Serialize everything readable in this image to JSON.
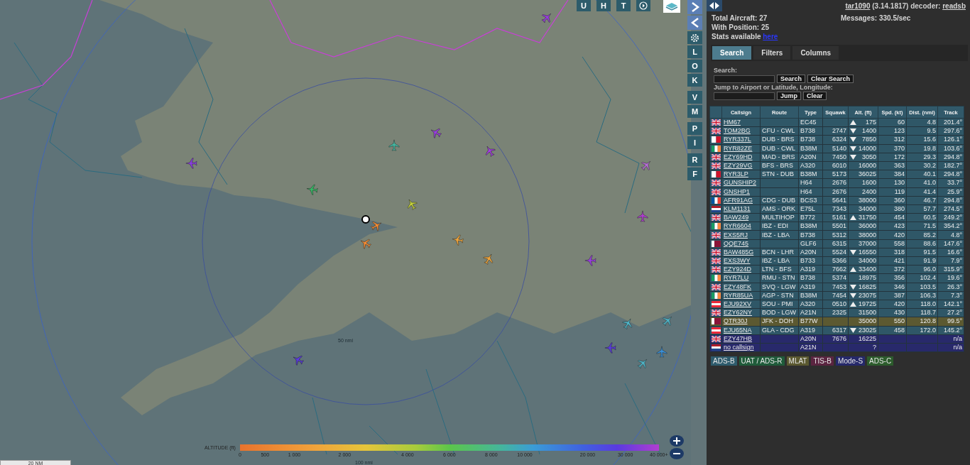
{
  "map": {
    "top_buttons": [
      "U",
      "H",
      "T"
    ],
    "side_buttons": [
      "L",
      "O",
      "K",
      "V",
      "M",
      "P",
      "I",
      "R",
      "F"
    ],
    "ring_labels": [
      "50 nmi",
      "100 nmi"
    ],
    "scale": "20 NM",
    "altitude_legend": {
      "title": "ALTITUDE (ft)",
      "ticks": [
        "0",
        "500",
        "1 000",
        "2 000",
        "4 000",
        "6 000",
        "8 000",
        "10 000",
        "20 000",
        "30 000",
        "40 000+"
      ]
    }
  },
  "panel": {
    "version": {
      "app": "tar1090",
      "build": " (3.14.1817) decoder: ",
      "decoder": "readsb"
    },
    "stats": {
      "total": "Total Aircraft: 27",
      "messages": "Messages: 330.5/sec",
      "with_position": "With Position: 25",
      "available": "Stats available ",
      "link": "here"
    },
    "tabs": [
      {
        "label": "Search",
        "selected": true
      },
      {
        "label": "Filters",
        "selected": false
      },
      {
        "label": "Columns",
        "selected": false
      }
    ],
    "search": {
      "label": "Search:",
      "buttons": [
        "Search",
        "Clear Search"
      ],
      "jump_label": "Jump to Airport or Latitude, Longitude:",
      "jump_buttons": [
        "Jump",
        "Clear"
      ]
    },
    "table": {
      "columns": [
        "Callsign",
        "Route",
        "Type",
        "Squawk",
        "Alt. (ft)",
        "Spd. (kt)",
        "Dist. (nmi)",
        "Track"
      ],
      "rows": [
        {
          "kind": "gb",
          "callsign": "HM67",
          "type": "EC45",
          "climbing": true,
          "descending": false,
          "alt": "175",
          "speed": "60",
          "dist": "4.8",
          "track": "201.4°",
          "color": "#2f5767"
        },
        {
          "kind": "gb",
          "callsign": "TOM2BG",
          "route": "CFU - CWL",
          "type": "B738",
          "squawk": "2747",
          "climbing": false,
          "descending": true,
          "alt": "1400",
          "speed": "123",
          "dist": "9.5",
          "track": "297.6°",
          "color": "#2f5767"
        },
        {
          "kind": "mt",
          "callsign": "RYR337L",
          "route": "DUB - BRS",
          "type": "B738",
          "squawk": "6324",
          "climbing": false,
          "descending": true,
          "alt": "7850",
          "speed": "312",
          "dist": "15.6",
          "track": "126.1°",
          "color": "#2f5767"
        },
        {
          "kind": "ie",
          "callsign": "RYR82ZE",
          "route": "DUB - CWL",
          "type": "B38M",
          "squawk": "5140",
          "climbing": false,
          "descending": true,
          "alt": "14000",
          "speed": "370",
          "dist": "19.8",
          "track": "103.6°",
          "color": "#2f5767"
        },
        {
          "kind": "gb",
          "callsign": "EZY69HD",
          "route": "MAD - BRS",
          "type": "A20N",
          "squawk": "7450",
          "climbing": false,
          "descending": true,
          "alt": "3050",
          "speed": "172",
          "dist": "29.3",
          "track": "294.8°",
          "color": "#2f5767"
        },
        {
          "kind": "gb",
          "callsign": "EZY29VG",
          "route": "BFS - BRS",
          "type": "A320",
          "squawk": "6010",
          "climbing": false,
          "descending": false,
          "alt": "16000",
          "speed": "363",
          "dist": "30.2",
          "track": "182.7°",
          "color": "#2f5767"
        },
        {
          "kind": "mt",
          "callsign": "RYR3LP",
          "route": "STN - DUB",
          "type": "B38M",
          "squawk": "5173",
          "climbing": false,
          "descending": false,
          "alt": "36025",
          "speed": "384",
          "dist": "40.1",
          "track": "294.8°",
          "color": "#2f5767"
        },
        {
          "kind": "gb",
          "callsign": "GUNSHIP2",
          "type": "H64",
          "squawk": "2676",
          "climbing": false,
          "descending": false,
          "alt": "1600",
          "speed": "130",
          "dist": "41.0",
          "track": "33.7°",
          "color": "#2f5767"
        },
        {
          "kind": "gb",
          "callsign": "GNSHP1",
          "type": "H64",
          "squawk": "2676",
          "climbing": false,
          "descending": false,
          "alt": "2400",
          "speed": "119",
          "dist": "41.4",
          "track": "25.9°",
          "color": "#2f5767"
        },
        {
          "kind": "fr",
          "callsign": "AFR91AG",
          "route": "CDG - DUB",
          "type": "BCS3",
          "squawk": "5641",
          "climbing": false,
          "descending": false,
          "alt": "38000",
          "speed": "360",
          "dist": "46.7",
          "track": "294.8°",
          "color": "#2f5767"
        },
        {
          "kind": "nl",
          "callsign": "KLM1131",
          "route": "AMS - ORK",
          "type": "E75L",
          "squawk": "7343",
          "climbing": false,
          "descending": false,
          "alt": "34000",
          "speed": "380",
          "dist": "57.7",
          "track": "274.5°",
          "color": "#2f5767"
        },
        {
          "kind": "gb",
          "callsign": "BAW249",
          "route": "MULTIHOP",
          "type": "B772",
          "squawk": "5161",
          "climbing": true,
          "descending": false,
          "alt": "31750",
          "speed": "454",
          "dist": "60.5",
          "track": "249.2°",
          "color": "#2f5767"
        },
        {
          "kind": "ie",
          "callsign": "RYR6604",
          "route": "IBZ - EDI",
          "type": "B38M",
          "squawk": "5501",
          "climbing": false,
          "descending": false,
          "alt": "36000",
          "speed": "423",
          "dist": "71.5",
          "track": "354.2°",
          "color": "#2f5767"
        },
        {
          "kind": "gb",
          "callsign": "EXS5RJ",
          "route": "IBZ - LBA",
          "type": "B738",
          "squawk": "5312",
          "climbing": false,
          "descending": false,
          "alt": "38000",
          "speed": "420",
          "dist": "85.2",
          "track": "4.8°",
          "color": "#2f5767"
        },
        {
          "kind": "qa",
          "callsign": "QQE745",
          "type": "GLF6",
          "squawk": "6315",
          "climbing": false,
          "descending": false,
          "alt": "37000",
          "speed": "558",
          "dist": "88.6",
          "track": "147.6°",
          "color": "#2f5767"
        },
        {
          "kind": "gb",
          "callsign": "BAW485G",
          "route": "BCN - LHR",
          "type": "A20N",
          "squawk": "5524",
          "climbing": false,
          "descending": true,
          "alt": "16550",
          "speed": "318",
          "dist": "91.5",
          "track": "16.6°",
          "color": "#2f5767"
        },
        {
          "kind": "gb",
          "callsign": "EXS3WY",
          "route": "IBZ - LBA",
          "type": "B733",
          "squawk": "5366",
          "climbing": false,
          "descending": false,
          "alt": "34000",
          "speed": "421",
          "dist": "91.9",
          "track": "7.9°",
          "color": "#2f5767"
        },
        {
          "kind": "gb",
          "callsign": "EZY924D",
          "route": "LTN - BFS",
          "type": "A319",
          "squawk": "7662",
          "climbing": true,
          "descending": false,
          "alt": "33400",
          "speed": "372",
          "dist": "96.0",
          "track": "315.9°",
          "color": "#2f5767"
        },
        {
          "kind": "ie",
          "callsign": "RYR7LU",
          "route": "RMU - STN",
          "type": "B738",
          "squawk": "5374",
          "climbing": false,
          "descending": false,
          "alt": "18975",
          "speed": "356",
          "dist": "102.4",
          "track": "19.6°",
          "color": "#2f5767"
        },
        {
          "kind": "gb",
          "callsign": "EZY48FK",
          "route": "SVQ - LGW",
          "type": "A319",
          "squawk": "7453",
          "climbing": false,
          "descending": true,
          "alt": "16825",
          "speed": "346",
          "dist": "103.5",
          "track": "26.3°",
          "color": "#2f5767"
        },
        {
          "kind": "ie",
          "callsign": "RYR85UA",
          "route": "AGP - STN",
          "type": "B38M",
          "squawk": "7454",
          "climbing": false,
          "descending": true,
          "alt": "23075",
          "speed": "387",
          "dist": "106.3",
          "track": "7.3°",
          "color": "#2f5767"
        },
        {
          "kind": "at",
          "callsign": "EJU92XV",
          "route": "SOU - PMI",
          "type": "A320",
          "squawk": "0510",
          "climbing": true,
          "descending": false,
          "alt": "19725",
          "speed": "420",
          "dist": "118.0",
          "track": "142.1°",
          "color": "#2f5767"
        },
        {
          "kind": "gb",
          "callsign": "EZY62NY",
          "route": "BOD - LGW",
          "type": "A21N",
          "squawk": "2325",
          "climbing": false,
          "descending": false,
          "alt": "31500",
          "speed": "430",
          "dist": "118.7",
          "track": "27.2°",
          "color": "#2f5767"
        },
        {
          "kind": "qa",
          "callsign": "QTR30J",
          "route": "JFK - DOH",
          "type": "B77W",
          "climbing": false,
          "descending": false,
          "alt": "35000",
          "speed": "550",
          "dist": "120.8",
          "track": "99.5°",
          "color": "#5c5931"
        },
        {
          "kind": "at",
          "callsign": "EJU65NA",
          "route": "GLA - CDG",
          "type": "A319",
          "squawk": "6317",
          "climbing": false,
          "descending": true,
          "alt": "23025",
          "speed": "458",
          "dist": "172.0",
          "track": "145.2°",
          "color": "#2f5767"
        },
        {
          "kind": "gb",
          "callsign": "EZY47HB",
          "type": "A20N",
          "squawk": "7676",
          "climbing": false,
          "descending": false,
          "alt": "16225",
          "track": "n/a",
          "color": "#28296b"
        },
        {
          "kind": "nl",
          "callsign": "no callsign",
          "type": "A21N",
          "climbing": false,
          "descending": false,
          "alt": "?",
          "track": "n/a",
          "color": "#28296b"
        }
      ]
    },
    "legend": [
      {
        "label": "ADS-B",
        "color": "#2e5b6c"
      },
      {
        "label": "UAT / ADS-R",
        "color": "#1f5b3a"
      },
      {
        "label": "MLAT",
        "color": "#5b5930"
      },
      {
        "label": "TIS-B",
        "color": "#5a2440"
      },
      {
        "label": "Mode-S",
        "color": "#25286a"
      },
      {
        "label": "ADS-C",
        "color": "#2c5c2c"
      }
    ]
  }
}
